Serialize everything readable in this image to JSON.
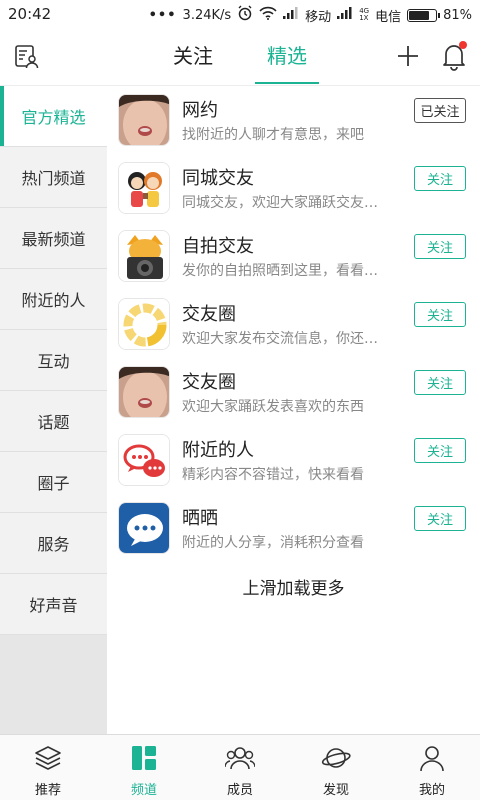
{
  "status_bar": {
    "time": "20:42",
    "dots": "•••",
    "speed": "3.24K/s",
    "carrier1": "移动",
    "net_4g": "4G",
    "net_1x": "1X",
    "carrier2": "电信",
    "battery": "81%",
    "battery_level": 0.81
  },
  "header": {
    "tabs": [
      {
        "label": "关注",
        "active": false
      },
      {
        "label": "精选",
        "active": true
      }
    ],
    "left_icon": "contacts-card-icon",
    "plus_icon": "plus-icon",
    "bell_icon": "bell-icon",
    "accent": "#1bb394"
  },
  "sidebar": {
    "items": [
      {
        "label": "官方精选",
        "active": true
      },
      {
        "label": "热门频道",
        "active": false
      },
      {
        "label": "最新频道",
        "active": false
      },
      {
        "label": "附近的人",
        "active": false
      },
      {
        "label": "互动",
        "active": false
      },
      {
        "label": "话题",
        "active": false
      },
      {
        "label": "圈子",
        "active": false
      },
      {
        "label": "服务",
        "active": false
      },
      {
        "label": "好声音",
        "active": false
      }
    ]
  },
  "channels": [
    {
      "title": "网约",
      "desc": "找附近的人聊才有意思，来吧",
      "button": "已关注",
      "followed": true,
      "avatar": "face-photo"
    },
    {
      "title": "同城交友",
      "desc": "同城交友，欢迎大家踊跃交友…",
      "button": "关注",
      "followed": false,
      "avatar": "cartoon-couple"
    },
    {
      "title": "自拍交友",
      "desc": "发你的自拍照晒到这里，看看…",
      "button": "关注",
      "followed": false,
      "avatar": "camera-dog"
    },
    {
      "title": "交友圈",
      "desc": "欢迎大家发布交流信息，你还…",
      "button": "关注",
      "followed": false,
      "avatar": "yellow-ring"
    },
    {
      "title": "交友圈",
      "desc": "欢迎大家踊跃发表喜欢的东西",
      "button": "关注",
      "followed": false,
      "avatar": "face-photo"
    },
    {
      "title": "附近的人",
      "desc": "精彩内容不容错过，快来看看",
      "button": "关注",
      "followed": false,
      "avatar": "red-chat-bubbles"
    },
    {
      "title": "晒晒",
      "desc": "附近的人分享，消耗积分查看",
      "button": "关注",
      "followed": false,
      "avatar": "blue-chat-bubble"
    }
  ],
  "load_more": "上滑加载更多",
  "bottom_nav": [
    {
      "label": "推荐",
      "icon": "layers-icon",
      "active": false
    },
    {
      "label": "频道",
      "icon": "grid-icon",
      "active": true
    },
    {
      "label": "成员",
      "icon": "members-icon",
      "active": false
    },
    {
      "label": "发现",
      "icon": "planet-icon",
      "active": false
    },
    {
      "label": "我的",
      "icon": "person-icon",
      "active": false
    }
  ]
}
